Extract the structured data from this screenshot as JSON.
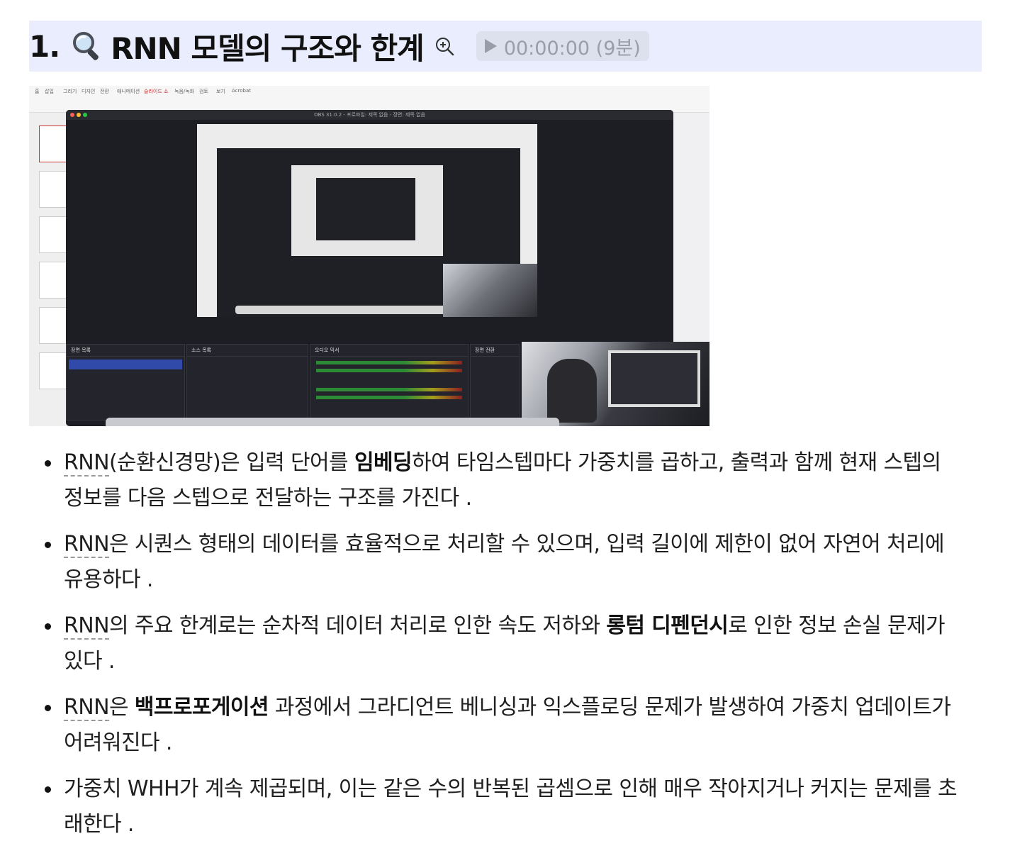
{
  "section": {
    "number": "1.",
    "title": "RNN 모델의 구조와 한계",
    "icon": "magnifier-emoji",
    "zoom_icon": "zoom-in-icon",
    "timestamp": "00:00:00 (9분)",
    "accent_bg": "#e9edfd"
  },
  "screenshot": {
    "obs_window_title": "OBS 31.0.2 - 프로파일: 제목 없음 - 장면: 제목 없음",
    "ribbon_tabs": [
      "홈",
      "삽입",
      "그리기",
      "디자인",
      "전환",
      "애니메이션",
      "슬라이드 쇼",
      "녹음/녹화",
      "검토",
      "보기",
      "Acrobat"
    ],
    "panels": [
      "장면 목록",
      "소스 목록",
      "오디오 믹서",
      "장면 전환"
    ]
  },
  "bullets": [
    {
      "term": "RNN",
      "parts": [
        "(순환신경망)은 입력 단어를 ",
        "임베딩",
        "하여 타임스텝마다 가중치를 곱하고, 출력과 함께 현재 스텝의 정보를 다음 스텝으로 전달하는 구조를 가진다 ."
      ]
    },
    {
      "term": "RNN",
      "parts": [
        "은 시퀀스 형태의 데이터를 효율적으로 처리할 수 있으며, 입력 길이에 제한이 없어 자연어 처리에 유용하다 .",
        "",
        ""
      ]
    },
    {
      "term": "RNN",
      "parts": [
        "의 주요 한계로는 순차적 데이터 처리로 인한 속도 저하와 ",
        "롱텀 디펜던시",
        "로 인한 정보 손실 문제가 있다 ."
      ]
    },
    {
      "term": "RNN",
      "parts": [
        "은 ",
        "백프로포게이션",
        " 과정에서 그라디언트 베니싱과 익스플로딩 문제가 발생하여 가중치 업데이트가 어려워진다 ."
      ]
    },
    {
      "term": "",
      "parts": [
        "가중치 WHH가 계속 제곱되며, 이는 같은 수의 반복된 곱셈으로 인해 매우 작아지거나 커지는 문제를 초래한다 .",
        "",
        ""
      ]
    }
  ]
}
